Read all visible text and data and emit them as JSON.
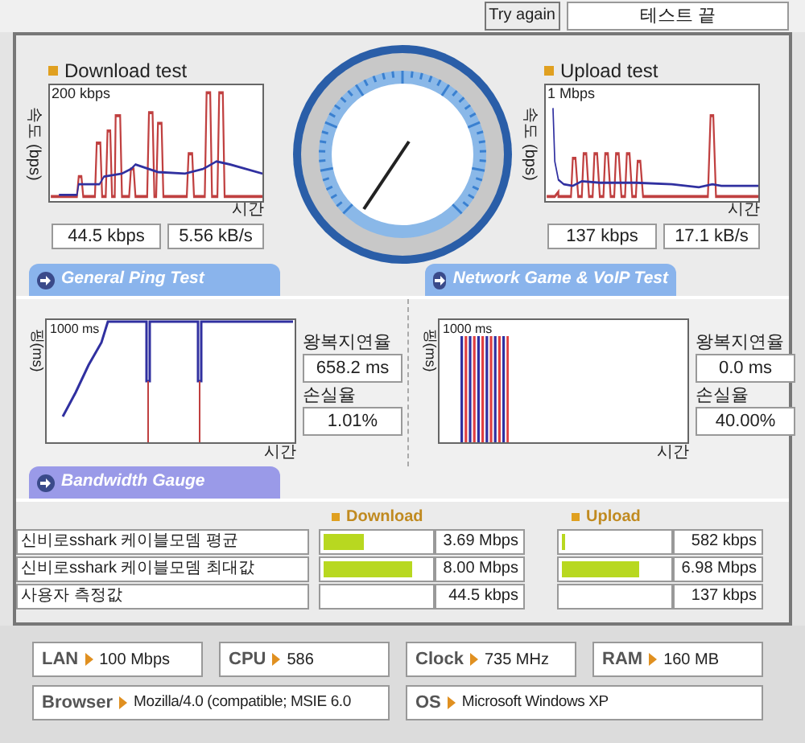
{
  "top_bar": {
    "try_again": "Try again",
    "status": "테스트 끝"
  },
  "speed_tests": [
    {
      "title": "Download test",
      "ylabel": "속도 (bps)",
      "scale": "200 kbps",
      "xlabel": "시간",
      "rate": "44.5 kbps",
      "throughput": "5.56 kB/s"
    },
    {
      "title": "Upload test",
      "ylabel": "속도 (bps)",
      "scale": "1 Mbps",
      "xlabel": "시간",
      "rate": "137 kbps",
      "throughput": "17.1 kB/s"
    }
  ],
  "ping_tabs": [
    "General Ping Test",
    "Network Game & VoIP Test"
  ],
  "ping_tests": [
    {
      "ylabel": "핑(ms)",
      "scale": "1000 ms",
      "xlabel": "시간",
      "latency_label": "왕복지연율",
      "latency": "658.2 ms",
      "loss_label": "손실율",
      "loss": "1.01%"
    },
    {
      "ylabel": "핑(ms)",
      "scale": "1000 ms",
      "xlabel": "시간",
      "latency_label": "왕복지연율",
      "latency": "0.0 ms",
      "loss_label": "손실율",
      "loss": "40.00%"
    }
  ],
  "bandwidth_tab": "Bandwidth Gauge",
  "bandwidth": {
    "download_header": "Download",
    "upload_header": "Upload",
    "rows": [
      {
        "name": "신비로sshark 케이블모뎀 평균",
        "download": {
          "level": 0.38,
          "value": "3.69 Mbps"
        },
        "upload": {
          "level": 0.03,
          "value": "582 kbps"
        }
      },
      {
        "name": "신비로sshark 케이블모뎀 최대값",
        "download": {
          "level": 0.83,
          "value": "8.00 Mbps"
        },
        "upload": {
          "level": 0.72,
          "value": "6.98 Mbps"
        }
      },
      {
        "name": "사용자 측정값",
        "download": {
          "value": "44.5 kbps"
        },
        "upload": {
          "value": "137 kbps"
        }
      }
    ]
  },
  "system_info": [
    [
      {
        "label": "LAN",
        "value": "100 Mbps"
      },
      {
        "label": "CPU",
        "value": "586"
      },
      {
        "label": "Clock",
        "value": "735 MHz"
      },
      {
        "label": "RAM",
        "value": "160 MB"
      }
    ],
    [
      {
        "label": "Browser",
        "value": "Mozilla/4.0 (compatible; MSIE 6.0"
      },
      {
        "label": "OS",
        "value": "Microsoft Windows XP"
      }
    ]
  ]
}
